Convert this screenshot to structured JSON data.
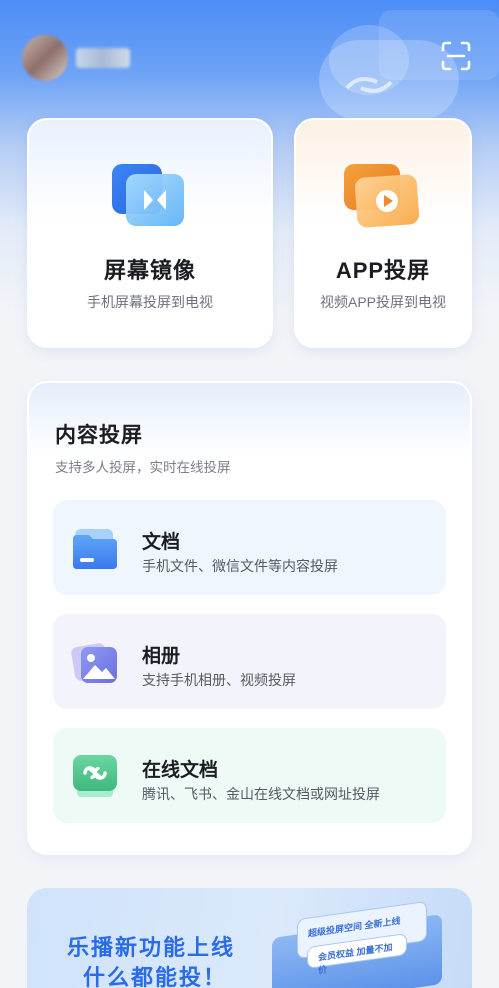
{
  "header": {
    "username": "■■■"
  },
  "cards": {
    "mirror": {
      "title": "屏幕镜像",
      "subtitle": "手机屏幕投屏到电视"
    },
    "app": {
      "title": "APP投屏",
      "subtitle": "视频APP投屏到电视"
    }
  },
  "content": {
    "title": "内容投屏",
    "subtitle": "支持多人投屏，实时在线投屏",
    "items": [
      {
        "title": "文档",
        "subtitle": "手机文件、微信文件等内容投屏"
      },
      {
        "title": "相册",
        "subtitle": "支持手机相册、视频投屏"
      },
      {
        "title": "在线文档",
        "subtitle": "腾讯、飞书、金山在线文档或网址投屏"
      }
    ]
  },
  "banner": {
    "line1": "乐播新功能上线",
    "line2": "什么都能投！",
    "card1": "超级投屏空间 全新上线",
    "card2": "会员权益 加量不加价"
  },
  "colors": {
    "accent": "#2a6ce8",
    "header_blue": "#4c8df6",
    "app_orange": "#f08a2c",
    "online_green": "#4fc58c",
    "album_purple": "#8a86e8"
  },
  "icons": {
    "scan": "scan-icon",
    "mirror": "screen-mirror-icon",
    "app": "play-icon",
    "doc": "folder-icon",
    "album": "image-icon",
    "online": "link-icon"
  }
}
